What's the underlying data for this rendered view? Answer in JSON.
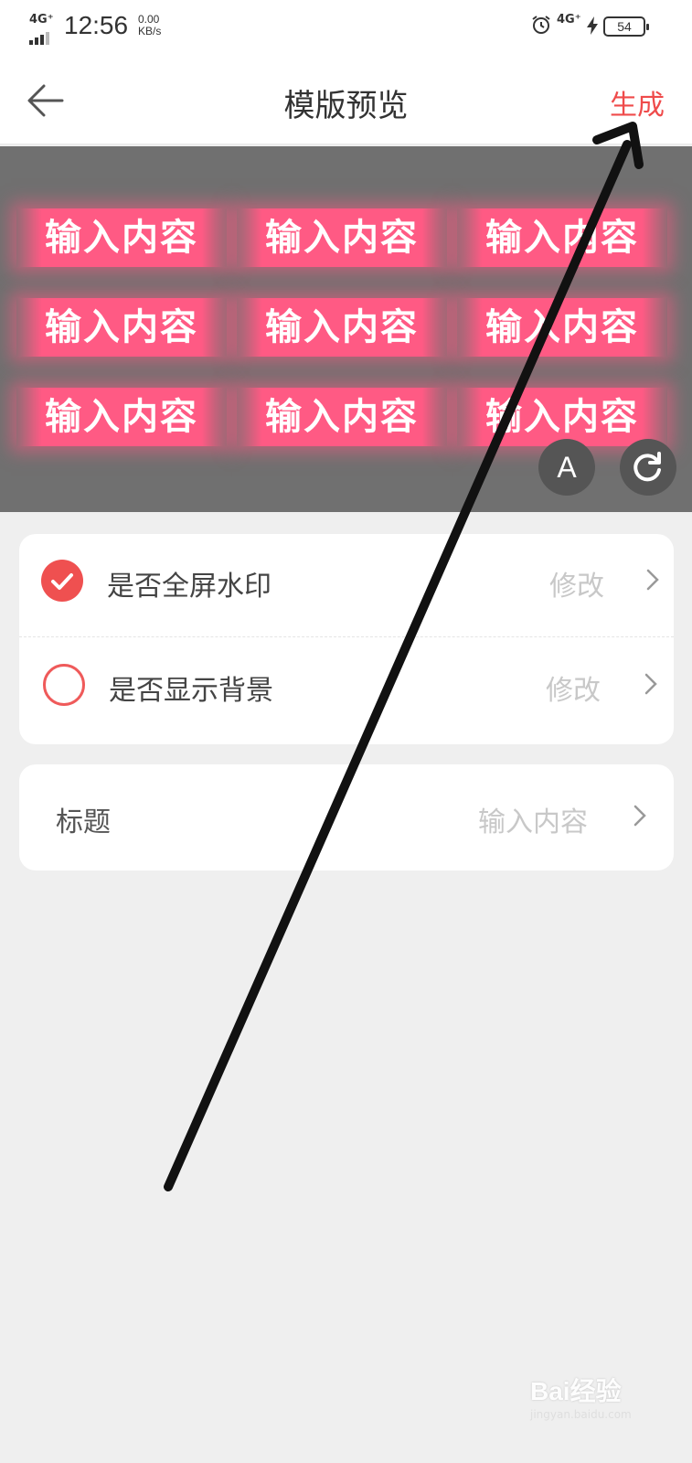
{
  "status_bar": {
    "network_left": "4G⁺",
    "time": "12:56",
    "speed_value": "0.00",
    "speed_unit": "KB/s",
    "network_right": "4G⁺",
    "battery": "54"
  },
  "nav": {
    "title": "模版预览",
    "generate_label": "生成",
    "back_icon": "arrow-left-icon"
  },
  "preview": {
    "watermark_text": "输入内容",
    "watermark_grid": {
      "rows": 3,
      "cols": 3
    },
    "font_button_label": "A",
    "refresh_icon": "refresh-icon",
    "background_color": "#707070",
    "watermark_color": "#ff5a84"
  },
  "settings": {
    "rows": [
      {
        "label": "是否全屏水印",
        "value": "修改",
        "checked": true
      },
      {
        "label": "是否显示背景",
        "value": "修改",
        "checked": false
      }
    ]
  },
  "title_card": {
    "label": "标题",
    "placeholder": "输入内容"
  },
  "accent_color": "#ef4b4b",
  "watermark_brand": {
    "text": "Bai经验",
    "sub": "jingyan.baidu.com"
  }
}
